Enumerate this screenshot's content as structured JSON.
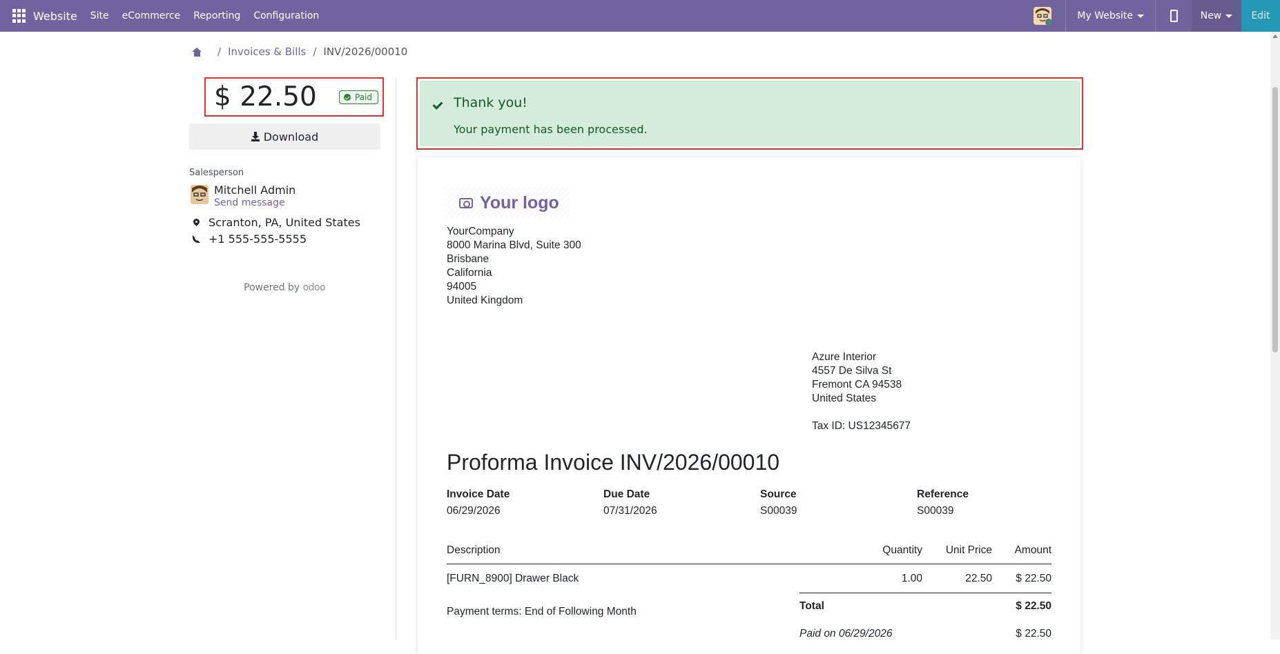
{
  "topbar": {
    "brand": "Website",
    "menu": [
      "Site",
      "eCommerce",
      "Reporting",
      "Configuration"
    ],
    "website_selector": "My Website",
    "new_label": "New",
    "edit_label": "Edit"
  },
  "breadcrumb": {
    "items": [
      "Invoices & Bills",
      "INV/2026/00010"
    ]
  },
  "sidebar": {
    "amount": "$ 22.50",
    "status": "Paid",
    "download_label": "Download",
    "salesperson_label": "Salesperson",
    "salesperson_name": "Mitchell Admin",
    "send_message": "Send message",
    "location": "Scranton, PA, United States",
    "phone": "+1 555-555-5555",
    "powered_by": "Powered by",
    "powered_brand": "odoo"
  },
  "alert": {
    "title": "Thank you!",
    "message": "Your payment has been processed."
  },
  "invoice": {
    "logo_text": "Your logo",
    "company": [
      "YourCompany",
      "8000 Marina Blvd, Suite 300",
      "Brisbane",
      "California",
      "94005",
      "United Kingdom"
    ],
    "customer": [
      "Azure Interior",
      "4557 De Silva St",
      "Fremont CA 94538",
      "United States"
    ],
    "tax_id": "Tax ID: US12345677",
    "title": "Proforma Invoice INV/2026/00010",
    "meta": [
      {
        "label": "Invoice Date",
        "value": "06/29/2026"
      },
      {
        "label": "Due Date",
        "value": "07/31/2026"
      },
      {
        "label": "Source",
        "value": "S00039"
      },
      {
        "label": "Reference",
        "value": "S00039"
      }
    ],
    "columns": [
      "Description",
      "Quantity",
      "Unit Price",
      "Amount"
    ],
    "lines": [
      {
        "description": "[FURN_8900] Drawer Black",
        "quantity": "1.00",
        "unit_price": "22.50",
        "amount": "$ 22.50"
      }
    ],
    "total_label": "Total",
    "total_value": "$ 22.50",
    "payment_terms": "Payment terms: End of Following Month",
    "paid_on_label": "Paid on 06/29/2026",
    "paid_on_value": "$ 22.50"
  }
}
